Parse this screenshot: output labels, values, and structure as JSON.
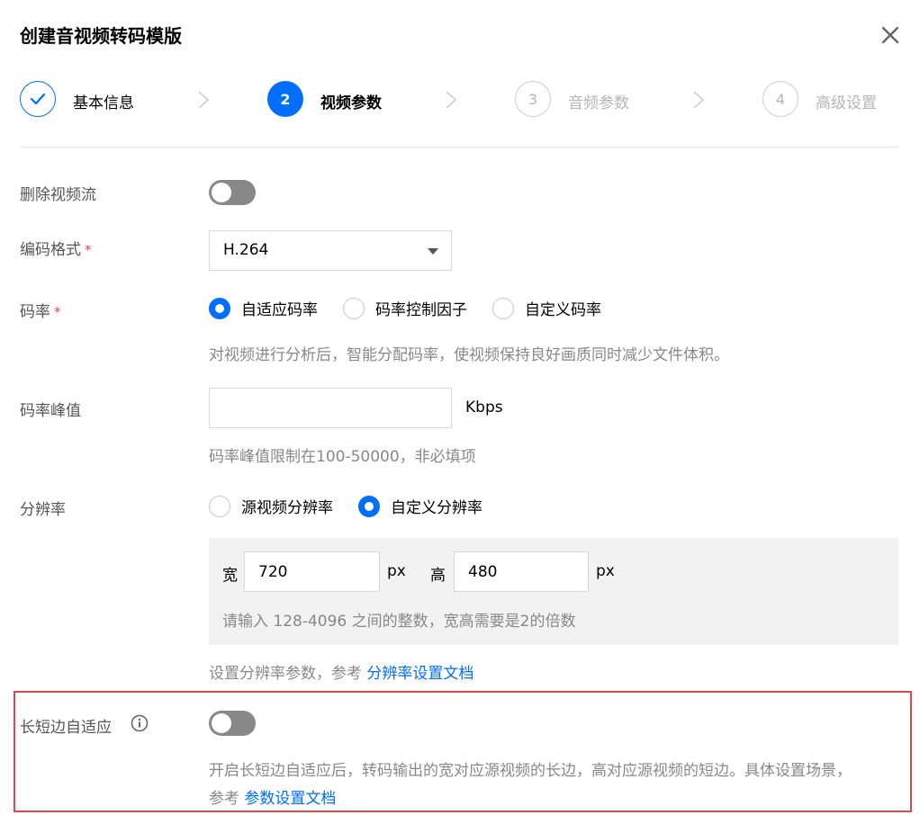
{
  "dialog": {
    "title": "创建音视频转码模版"
  },
  "steps": [
    {
      "number": "✓",
      "label": "基本信息",
      "state": "done"
    },
    {
      "number": "2",
      "label": "视频参数",
      "state": "active"
    },
    {
      "number": "3",
      "label": "音频参数",
      "state": "todo"
    },
    {
      "number": "4",
      "label": "高级设置",
      "state": "todo"
    }
  ],
  "form": {
    "remove_video": {
      "label": "删除视频流",
      "enabled": false
    },
    "codec": {
      "label": "编码格式",
      "required_mark": "*",
      "value": "H.264"
    },
    "bitrate": {
      "label": "码率",
      "required_mark": "*",
      "options": [
        "自适应码率",
        "码率控制因子",
        "自定义码率"
      ],
      "selected": "自适应码率",
      "help": "对视频进行分析后，智能分配码率，使视频保持良好画质同时减少文件体积。"
    },
    "peak_bitrate": {
      "label": "码率峰值",
      "value": "",
      "unit": "Kbps",
      "help": "码率峰值限制在100-50000，非必填项"
    },
    "resolution": {
      "label": "分辨率",
      "options": [
        "源视频分辨率",
        "自定义分辨率"
      ],
      "selected": "自定义分辨率",
      "width_label": "宽",
      "width_value": "720",
      "height_label": "高",
      "height_value": "480",
      "unit": "px",
      "box_help": "请输入 128-4096 之间的整数，宽高需要是2的倍数",
      "help_prefix": "设置分辨率参数，参考 ",
      "help_link": "分辨率设置文档"
    },
    "adaptive_edge": {
      "label": "长短边自适应",
      "enabled": false,
      "help_line1": "开启长短边自适应后，转码输出的宽对应源视频的长边，高对应源视频的短边。具体设置场景，",
      "help_prefix": "参考 ",
      "help_link": "参数设置文档"
    }
  },
  "colors": {
    "primary": "#006eff",
    "required": "#e54545",
    "highlight_border": "#e54545"
  }
}
